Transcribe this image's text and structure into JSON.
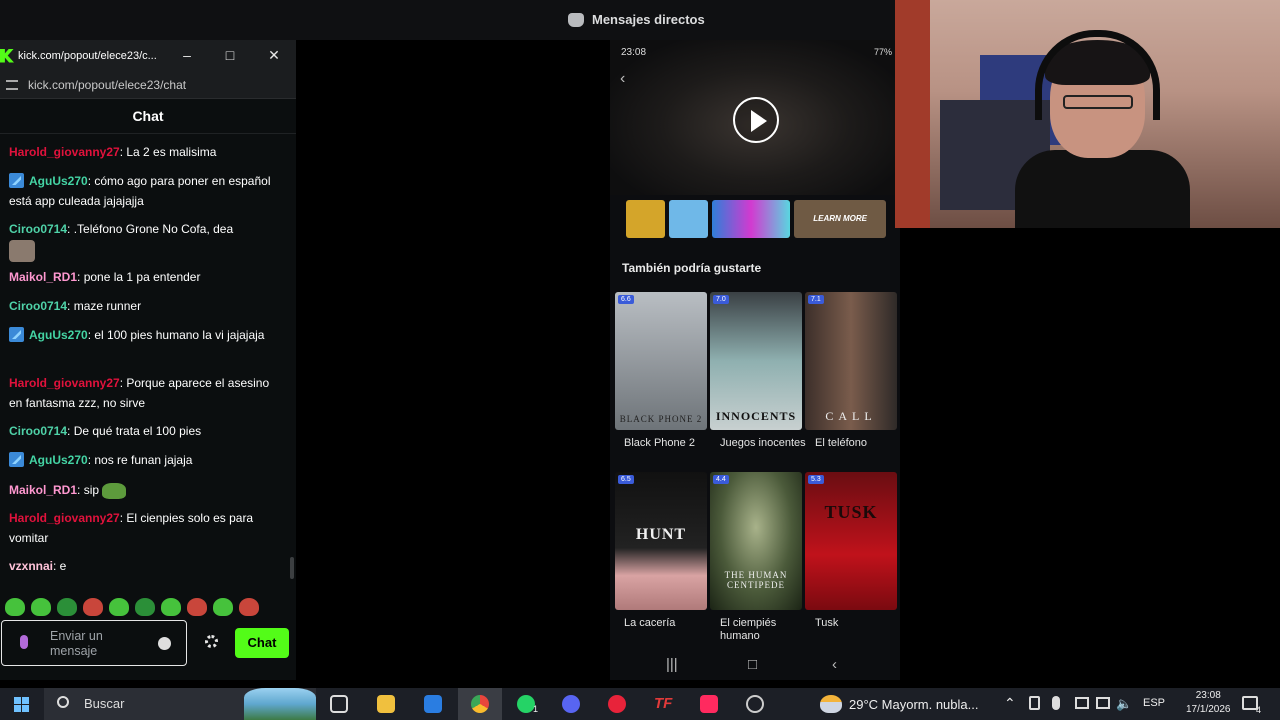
{
  "discord": {
    "title": "Mensajes directos"
  },
  "popout": {
    "window_title": "kick.com/popout/elece23/c...",
    "url": "kick.com/popout/elece23/chat",
    "chat_header": "Chat",
    "messages": [
      {
        "user": "Harold_giovanny27",
        "color": "#e1123c",
        "text": ": La 2 es malisima",
        "badge": false
      },
      {
        "user": "AguUs270",
        "color": "#44d4a4",
        "text": ": cómo ago para poner en español está app culeada jajajajja",
        "badge": true
      },
      {
        "user": "Ciroo0714",
        "color": "#4fd2a8",
        "text": ": .Teléfono Grone No Cofa, dea",
        "badge": false
      },
      {
        "user": "Maikol_RD1",
        "color": "#ff98d0",
        "text": ": pone la 1 pa entender",
        "badge": false
      },
      {
        "user": "Ciroo0714",
        "color": "#4fd2a8",
        "text": ": maze runner",
        "badge": false
      },
      {
        "user": "AguUs270",
        "color": "#44d4a4",
        "text": ": el 100 pies humano la vi jajajaja",
        "badge": true
      },
      {
        "user": "Harold_giovanny27",
        "color": "#e1123c",
        "text": ": Porque aparece el asesino en fantasma zzz, no sirve",
        "badge": false
      },
      {
        "user": "Ciroo0714",
        "color": "#4fd2a8",
        "text": ": De qué trata el 100 pies",
        "badge": false
      },
      {
        "user": "AguUs270",
        "color": "#44d4a4",
        "text": ": nos re funan jajaja",
        "badge": true
      },
      {
        "user": "Maikol_RD1",
        "color": "#ff98d0",
        "text": ": sip",
        "badge": false
      },
      {
        "user": "Harold_giovanny27",
        "color": "#e1123c",
        "text": ": El cienpies solo es para vomitar",
        "badge": false
      },
      {
        "user": "vzxnnai",
        "color": "#ffc3d9",
        "text": ": e",
        "badge": false
      }
    ],
    "input_placeholder": "Enviar un mensaje",
    "send_label": "Chat",
    "accent": "#53fc18"
  },
  "phone": {
    "time": "23:08",
    "battery": "77%",
    "learn_more": "LEARN MORE",
    "section_title": "También podría gustarte",
    "movies": [
      {
        "title": "Black Phone 2",
        "rating": "6.6",
        "poster_text": "BLACK PHONE 2"
      },
      {
        "title": "Juegos inocentes",
        "rating": "7.0",
        "poster_text": "INNOCENTS"
      },
      {
        "title": "El teléfono",
        "rating": "7.1",
        "poster_text": "CALL"
      },
      {
        "title": "La cacería",
        "rating": "6.5",
        "poster_text": "HUNT"
      },
      {
        "title": "El ciempiés humano",
        "rating": "4.4",
        "poster_text": "THE HUMAN CENTIPEDE"
      },
      {
        "title": "Tusk",
        "rating": "5.3",
        "poster_text": "TUSK"
      }
    ]
  },
  "taskbar": {
    "search_placeholder": "Buscar",
    "weather": "29°C  Mayorm. nubla...",
    "language": "ESP",
    "time": "23:08",
    "date": "17/1/2026",
    "notifications": "4",
    "whatsapp_badge": "1"
  }
}
